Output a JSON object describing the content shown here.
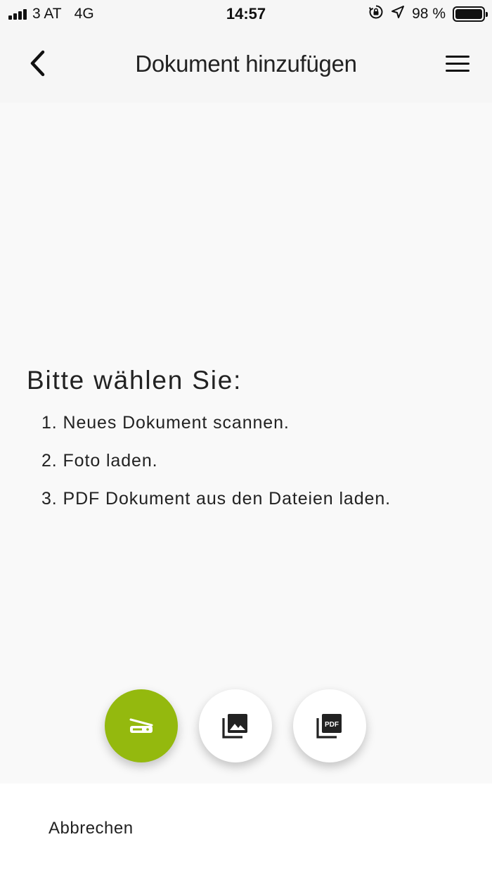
{
  "status_bar": {
    "carrier": "3 AT",
    "network": "4G",
    "time": "14:57",
    "battery": "98 %"
  },
  "header": {
    "title": "Dokument hinzufügen"
  },
  "instructions": {
    "heading": "Bitte wählen Sie:",
    "steps": [
      "1. Neues Dokument scannen.",
      "2. Foto laden.",
      "3. PDF Dokument aus den Dateien laden."
    ]
  },
  "actions": {
    "pdf_icon_text": "PDF"
  },
  "bottom_sheet": {
    "cancel_label": "Abbrechen"
  },
  "colors": {
    "accent": "#94b90e",
    "background": "#f9f9f9",
    "sheet": "#ffffff"
  }
}
